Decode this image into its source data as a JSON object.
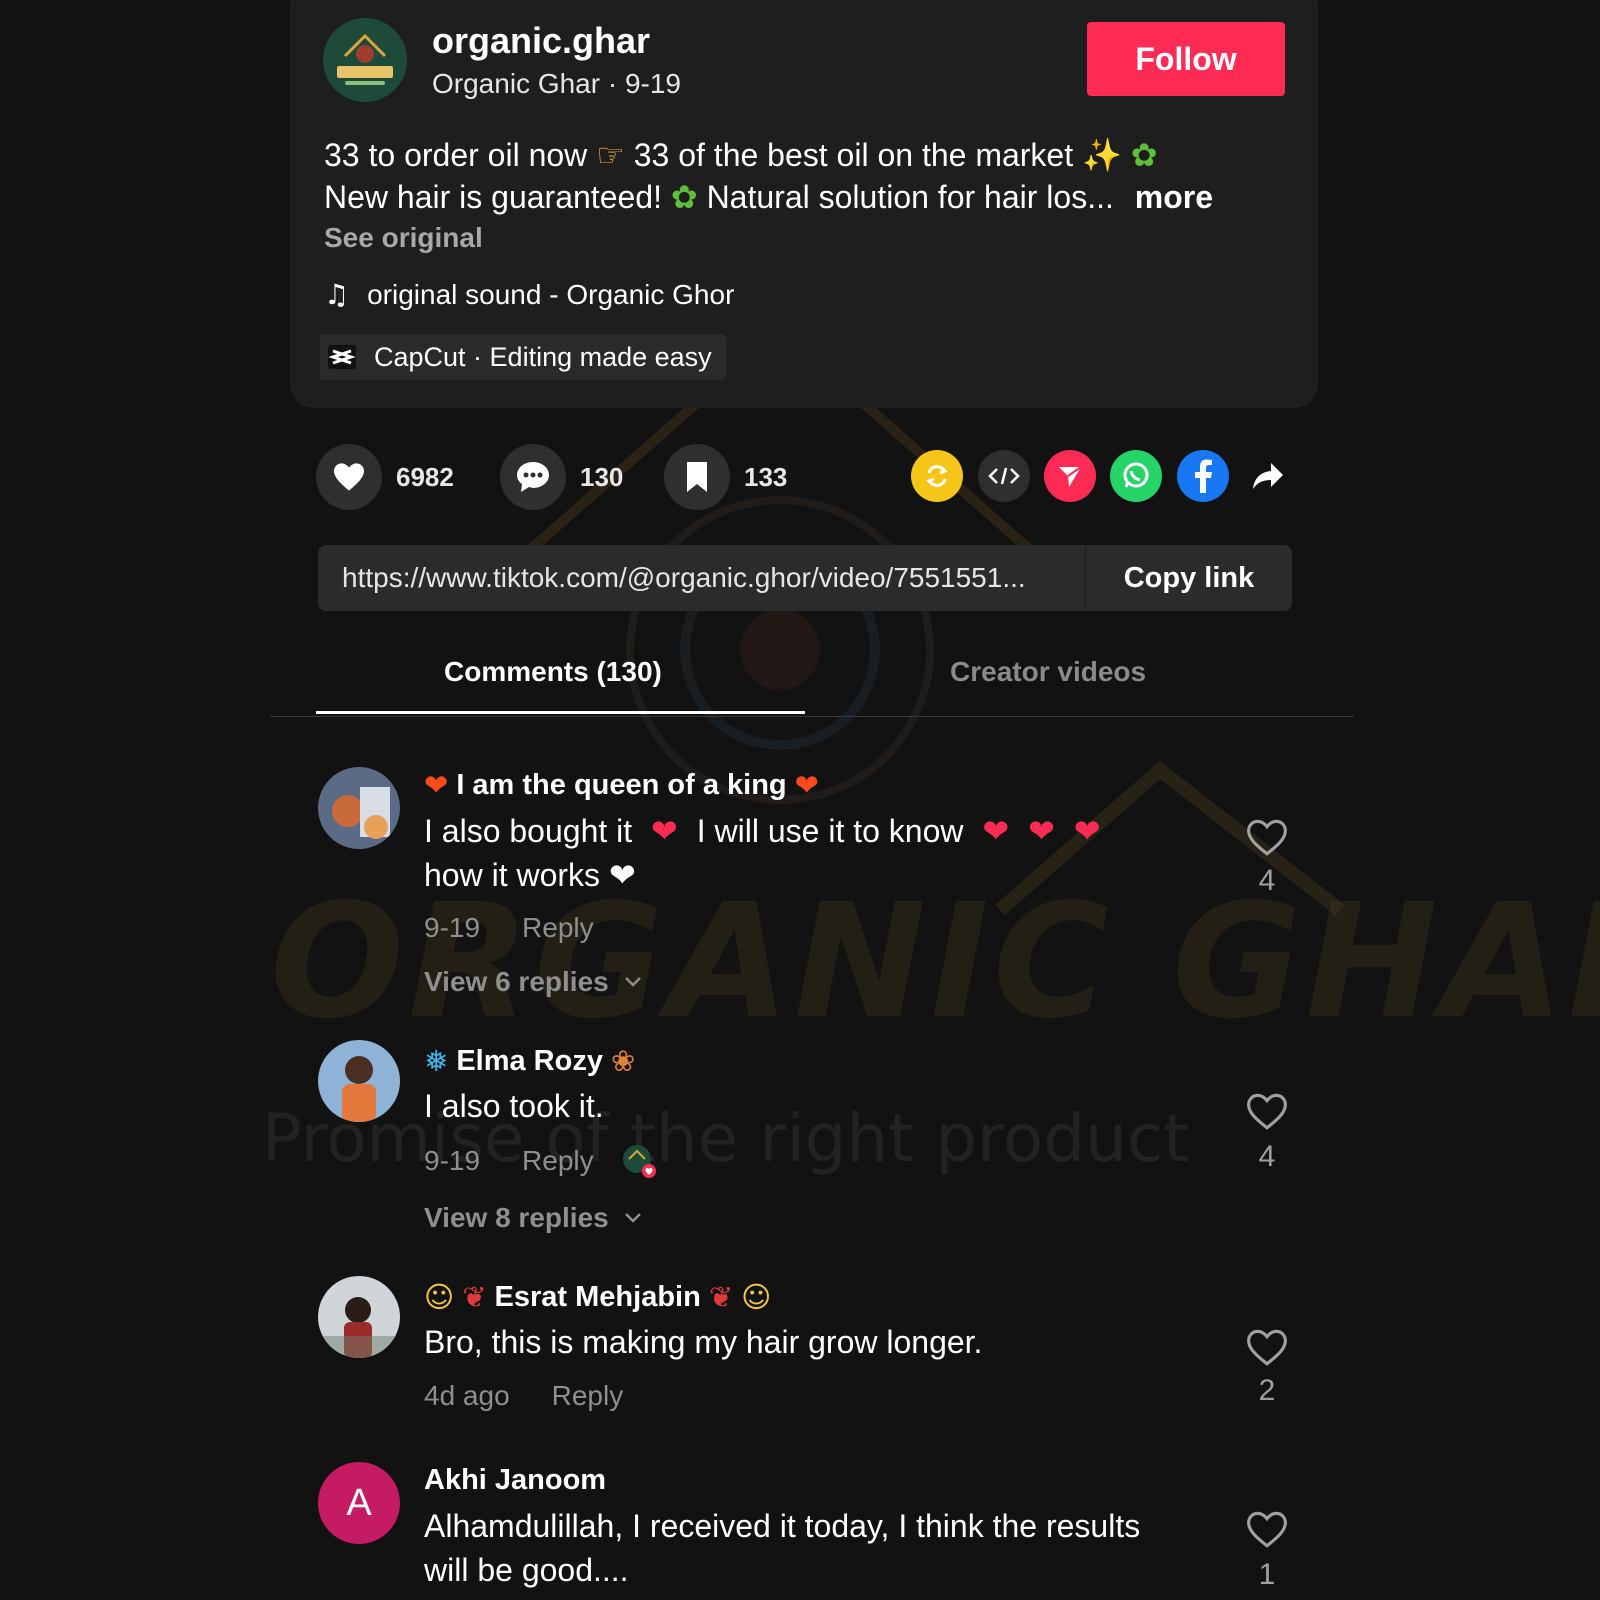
{
  "post": {
    "author_handle": "organic.ghar",
    "author_name_date": "Organic Ghar · 9-19",
    "follow_label": "Follow",
    "description_line1": "33 to order oil now",
    "description_line1b": "33 of the best oil on the market",
    "description_line2": "New hair is guaranteed!",
    "description_line2b": "Natural solution for hair los...",
    "more_label": "more",
    "see_original_label": "See original",
    "sound_label": "original sound - Organic Ghor",
    "capcut_label": "CapCut · Editing made easy"
  },
  "actions": {
    "likes": "6982",
    "comments": "130",
    "saves": "133"
  },
  "share": {
    "icons": [
      "repost-icon",
      "embed-icon",
      "send-icon",
      "whatsapp-icon",
      "facebook-icon",
      "share-arrow-icon"
    ],
    "colors": {
      "repost": "#f5c518",
      "embed": "#2f2f2f",
      "send": "#fe2c55",
      "whatsapp": "#25d366",
      "facebook": "#1877f2"
    }
  },
  "link": {
    "url": "https://www.tiktok.com/@organic.ghor/video/7551551...",
    "copy_label": "Copy link"
  },
  "tabs": {
    "comments_label": "Comments (130)",
    "creator_label": "Creator videos"
  },
  "watermark": {
    "brand": "ORGANIC GHAR",
    "tagline": "Promise of the right product"
  },
  "comments": [
    {
      "name": "I am the queen of a king",
      "text_a": "I also bought it",
      "text_b": "I will use it to know",
      "text_c": "how it works",
      "date": "9-19",
      "reply_label": "Reply",
      "view_replies": "View 6 replies",
      "likes": "4"
    },
    {
      "name": "Elma Rozy",
      "text": "I also took it.",
      "date": "9-19",
      "reply_label": "Reply",
      "view_replies": "View 8 replies",
      "likes": "4"
    },
    {
      "name": "Esrat Mehjabin",
      "text": "Bro, this is making my hair grow longer.",
      "date": "4d ago",
      "reply_label": "Reply",
      "likes": "2"
    },
    {
      "name": "Akhi Janoom",
      "initial": "A",
      "text_a": "Alhamdulillah, I received it today, I think the results",
      "text_b": "will be good....",
      "likes": "1"
    }
  ],
  "theme": {
    "background": "#121212",
    "card": "#1e1e1e",
    "accent": "#fe2c55"
  }
}
